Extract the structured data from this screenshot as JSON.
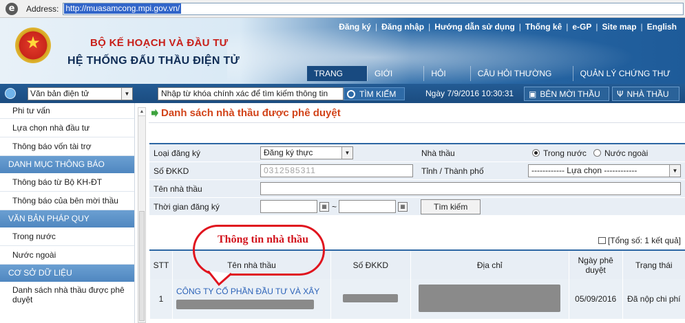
{
  "browser": {
    "address_label": "Address:",
    "url": "http://muasamcong.mpi.gov.vn/"
  },
  "header": {
    "org_line1": "BỘ KẾ HOẠCH VÀ ĐẦU TƯ",
    "org_line2": "HỆ THỐNG ĐẤU THẦU ĐIỆN TỬ",
    "top_links": [
      "Đăng ký",
      "Đăng nhập",
      "Hướng dẫn sử dụng",
      "Thống kê",
      "e-GP",
      "Site map",
      "English"
    ],
    "nav": [
      "TRANG CHỦ",
      "GIỚI THIỆU",
      "HỎI ĐÁP",
      "CÂU HỎI THƯỜNG GẶP",
      "QUẢN LÝ CHỨNG THƯ SỐ"
    ]
  },
  "toolbar": {
    "doc_select": "Văn bản điện tử",
    "search_value": "Nhập từ khóa chính xác để tìm kiếm thông tin",
    "search_button": "TÌM KIẾM",
    "date": "Ngày 7/9/2016 10:30:31",
    "btn_inviter": "BÊN MỜI THẦU",
    "btn_contractor": "NHÀ THẦU"
  },
  "sidebar": {
    "items_top": [
      "Phi tư vấn",
      "Lựa chọn nhà đầu tư",
      "Thông báo vốn tài trợ"
    ],
    "head1": "DANH MỤC THÔNG BÁO",
    "items1": [
      "Thông báo từ Bộ KH-ĐT",
      "Thông báo của bên mời thầu"
    ],
    "head2": "VĂN BẢN PHÁP QUY",
    "items2": [
      "Trong nước",
      "Nước ngoài"
    ],
    "head3": "CƠ SỞ DỮ LIỆU",
    "items3": [
      "Danh sách nhà thầu được phê duyệt"
    ]
  },
  "main": {
    "title": "Danh sách nhà thầu được phê duyệt",
    "form": {
      "reg_type_label": "Loại đăng ký",
      "reg_type_value": "Đăng ký thực",
      "contractor_label": "Nhà thầu",
      "radio_domestic": "Trong nước",
      "radio_foreign": "Nước ngoài",
      "dkkd_label": "Số ĐKKD",
      "dkkd_value": "0312585311",
      "province_label": "Tỉnh / Thành phố",
      "province_value": "------------ Lựa chọn ------------",
      "name_label": "Tên nhà thầu",
      "name_value": "",
      "time_label": "Thời gian đăng ký",
      "time_sep": "~",
      "search_button": "Tìm kiếm"
    },
    "total": "[Tổng số: 1 kết quả]",
    "table": {
      "headers": [
        "STT",
        "Tên nhà thầu",
        "Số ĐKKD",
        "Địa chỉ",
        "Ngày phê duyệt",
        "Trạng thái"
      ],
      "row": {
        "stt": "1",
        "name": "CÔNG TY CỔ PHẦN ĐẦU TƯ VÀ XÂY",
        "date": "05/09/2016",
        "status": "Đã nộp chi phí"
      }
    },
    "annotation": "Thông tin nhà thầu"
  },
  "colors": {
    "accent_blue": "#2c66a3",
    "title_orange": "#d2441a",
    "annotation_red": "#e0141e"
  }
}
